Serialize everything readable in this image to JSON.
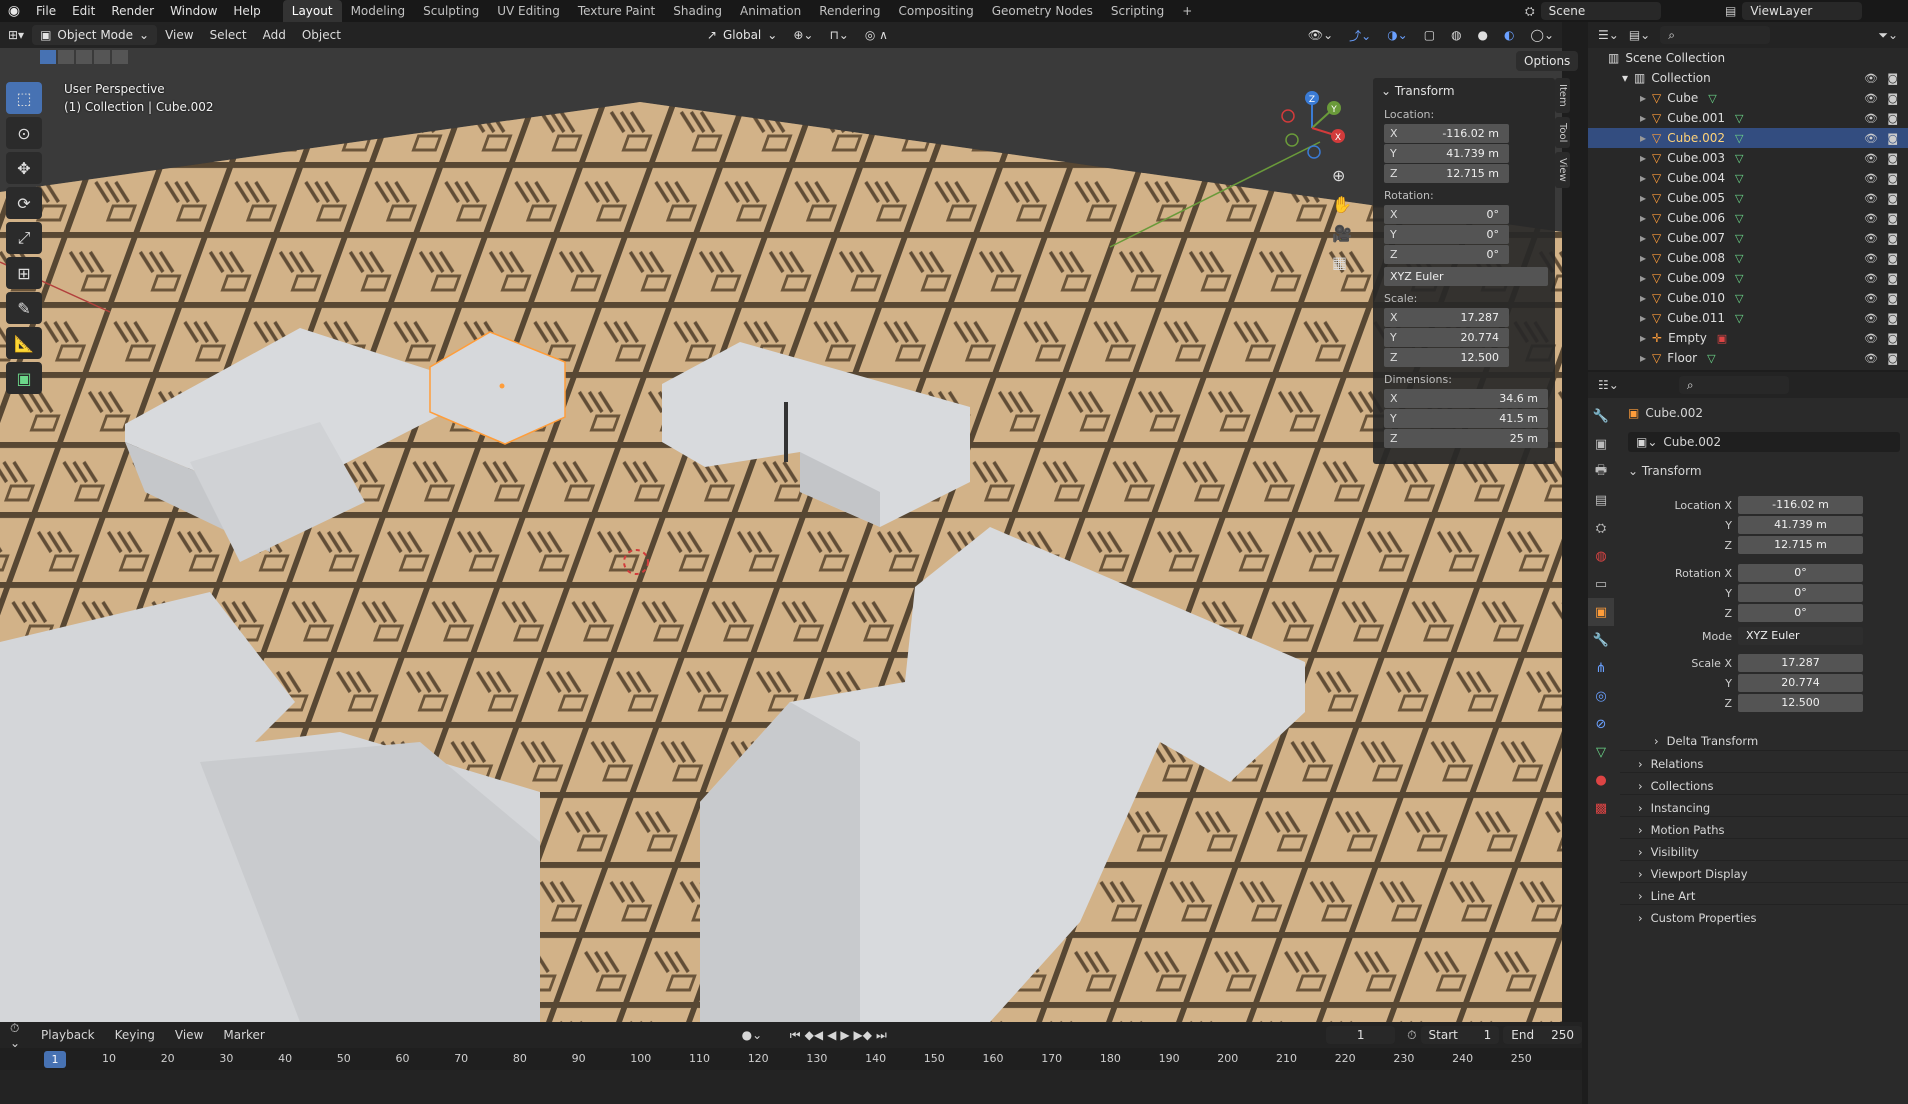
{
  "menubar": {
    "items": [
      "File",
      "Edit",
      "Render",
      "Window",
      "Help"
    ],
    "workspaces": [
      "Layout",
      "Modeling",
      "Sculpting",
      "UV Editing",
      "Texture Paint",
      "Shading",
      "Animation",
      "Rendering",
      "Compositing",
      "Geometry Nodes",
      "Scripting"
    ],
    "active_workspace": "Layout",
    "add_tab": "+",
    "scene": "Scene",
    "view_layer": "ViewLayer"
  },
  "viewport": {
    "mode": "Object Mode",
    "menus": [
      "View",
      "Select",
      "Add",
      "Object"
    ],
    "transform_orientation": "Global",
    "options": "Options",
    "perspective_label": "User Perspective",
    "collection_label": "(1) Collection | Cube.002",
    "gizmo_axes": {
      "x": "X",
      "y": "Y",
      "z": "Z"
    }
  },
  "npanel": {
    "tabs": [
      "Item",
      "Tool",
      "View"
    ],
    "title": "Transform",
    "location_label": "Location:",
    "rotation_label": "Rotation:",
    "scale_label": "Scale:",
    "dimensions_label": "Dimensions:",
    "location": {
      "x": "-116.02 m",
      "y": "41.739 m",
      "z": "12.715 m"
    },
    "rotation": {
      "x": "0°",
      "y": "0°",
      "z": "0°"
    },
    "rotation_mode": "XYZ Euler",
    "scale": {
      "x": "17.287",
      "y": "20.774",
      "z": "12.500"
    },
    "dimensions": {
      "x": "34.6 m",
      "y": "41.5 m",
      "z": "25 m"
    }
  },
  "outliner": {
    "scene_collection": "Scene Collection",
    "collection": "Collection",
    "items": [
      "Cube",
      "Cube.001",
      "Cube.002",
      "Cube.003",
      "Cube.004",
      "Cube.005",
      "Cube.006",
      "Cube.007",
      "Cube.008",
      "Cube.009",
      "Cube.010",
      "Cube.011",
      "Empty",
      "Floor"
    ],
    "selected": "Cube.002"
  },
  "properties": {
    "object_name": "Cube.002",
    "object_field": "Cube.002",
    "transform_header": "Transform",
    "location_x_label": "Location X",
    "rotation_x_label": "Rotation X",
    "scale_x_label": "Scale X",
    "y_label": "Y",
    "z_label": "Z",
    "mode_label": "Mode",
    "location": {
      "x": "-116.02 m",
      "y": "41.739 m",
      "z": "12.715 m"
    },
    "rotation": {
      "x": "0°",
      "y": "0°",
      "z": "0°"
    },
    "mode": "XYZ Euler",
    "scale": {
      "x": "17.287",
      "y": "20.774",
      "z": "12.500"
    },
    "subsections": [
      "Delta Transform",
      "Relations",
      "Collections",
      "Instancing",
      "Motion Paths",
      "Visibility",
      "Viewport Display",
      "Line Art",
      "Custom Properties"
    ]
  },
  "timeline": {
    "menus": [
      "Playback",
      "Keying",
      "View",
      "Marker"
    ],
    "current_frame": "1",
    "start_label": "Start",
    "start": "1",
    "end_label": "End",
    "end": "250",
    "ruler": [
      "10",
      "20",
      "30",
      "40",
      "50",
      "60",
      "70",
      "80",
      "90",
      "100",
      "110",
      "120",
      "130",
      "140",
      "150",
      "160",
      "170",
      "180",
      "190",
      "200",
      "210",
      "220",
      "230",
      "240",
      "250"
    ],
    "playhead": "1"
  },
  "colors": {
    "accent": "#4772b3",
    "selected_text": "#ffd47a",
    "object_orange": "#ff9d3a",
    "mesh_green": "#6cd88a"
  }
}
